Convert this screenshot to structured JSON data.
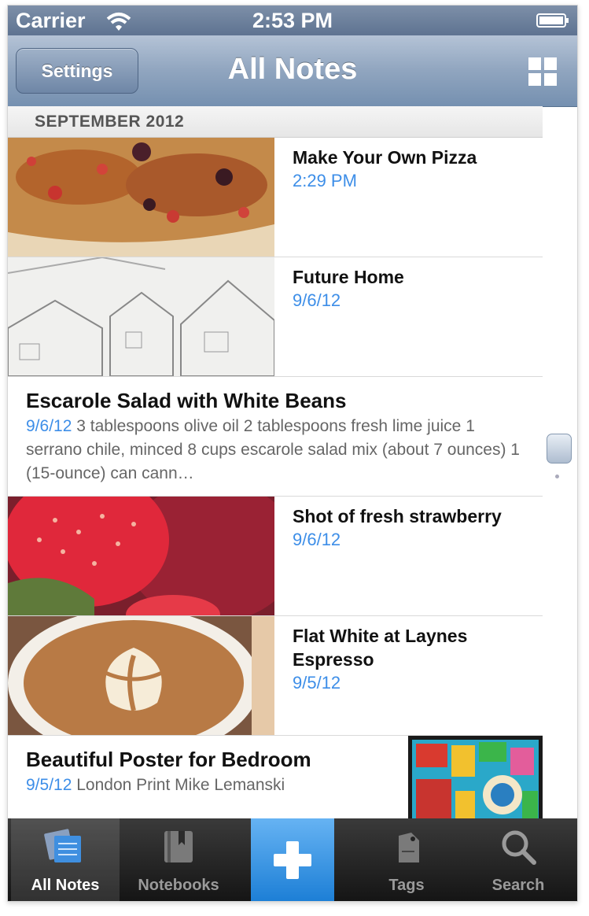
{
  "status_bar": {
    "carrier": "Carrier",
    "time": "2:53 PM"
  },
  "nav": {
    "settings_label": "Settings",
    "title": "All Notes"
  },
  "section": {
    "header": "SEPTEMBER 2012"
  },
  "notes": [
    {
      "title": "Make Your Own Pizza",
      "date": "2:29 PM"
    },
    {
      "title": "Future Home",
      "date": "9/6/12"
    },
    {
      "title": "Escarole Salad with White Beans",
      "date": "9/6/12",
      "snippet": "3 tablespoons olive oil 2 tablespoons fresh lime juice 1 serrano chile, minced 8 cups escarole salad mix (about 7 ounces) 1 (15-ounce) can cann…"
    },
    {
      "title": "Shot of fresh strawberry",
      "date": "9/6/12"
    },
    {
      "title": "Flat White at Laynes Espresso",
      "date": "9/5/12"
    },
    {
      "title": "Beautiful  Poster for Bedroom",
      "date": "9/5/12",
      "snippet": "London Print Mike Lemanski"
    }
  ],
  "tabs": [
    {
      "label": "All Notes",
      "icon": "notes-icon",
      "active": true
    },
    {
      "label": "Notebooks",
      "icon": "notebook-icon"
    },
    {
      "label": "",
      "icon": "plus-icon"
    },
    {
      "label": "Tags",
      "icon": "tag-icon"
    },
    {
      "label": "Search",
      "icon": "search-icon"
    }
  ],
  "colors": {
    "accent": "#3d8ee8",
    "navbar": "#8aa0bc",
    "tabbar": "#1e1e1e"
  }
}
